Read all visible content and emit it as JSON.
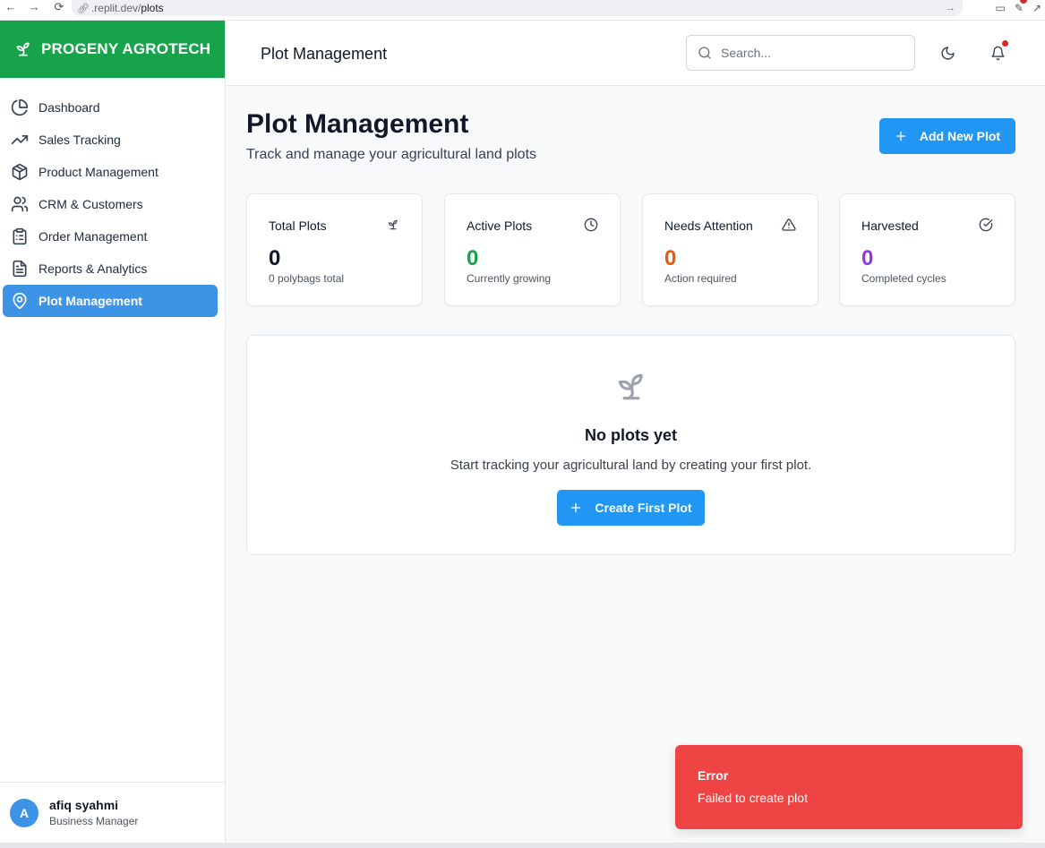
{
  "browser": {
    "url_prefix": ".replit.dev/",
    "url_path": "plots"
  },
  "sidebar": {
    "brand": "PROGENY AGROTECH",
    "items": [
      {
        "label": "Dashboard",
        "icon": "chart-pie-icon",
        "active": false
      },
      {
        "label": "Sales Tracking",
        "icon": "trending-up-icon",
        "active": false
      },
      {
        "label": "Product Management",
        "icon": "package-icon",
        "active": false
      },
      {
        "label": "CRM & Customers",
        "icon": "users-icon",
        "active": false
      },
      {
        "label": "Order Management",
        "icon": "clipboard-list-icon",
        "active": false
      },
      {
        "label": "Reports & Analytics",
        "icon": "file-text-icon",
        "active": false
      },
      {
        "label": "Plot Management",
        "icon": "map-pin-icon",
        "active": true
      }
    ],
    "user": {
      "initial": "A",
      "name": "afiq syahmi",
      "role": "Business Manager"
    }
  },
  "header": {
    "title": "Plot Management",
    "search_placeholder": "Search..."
  },
  "main": {
    "title": "Plot Management",
    "subtitle": "Track and manage your agricultural land plots",
    "add_button": "Add New Plot",
    "stats": [
      {
        "label": "Total Plots",
        "value": "0",
        "caption": "0 polybags total",
        "color": "#111827",
        "icon": "sprout-icon"
      },
      {
        "label": "Active Plots",
        "value": "0",
        "caption": "Currently growing",
        "color": "#16a34a",
        "icon": "clock-icon"
      },
      {
        "label": "Needs Attention",
        "value": "0",
        "caption": "Action required",
        "color": "#ea580c",
        "icon": "alert-triangle-icon"
      },
      {
        "label": "Harvested",
        "value": "0",
        "caption": "Completed cycles",
        "color": "#9333ea",
        "icon": "check-circle-icon"
      }
    ],
    "empty": {
      "title": "No plots yet",
      "text": "Start tracking your agricultural land by creating your first plot.",
      "button": "Create First Plot"
    }
  },
  "toast": {
    "title": "Error",
    "message": "Failed to create plot"
  },
  "colors": {
    "brand": "#16a34a",
    "accent": "#2196f3",
    "active_nav": "#3d94e6",
    "error": "#ef4444"
  }
}
